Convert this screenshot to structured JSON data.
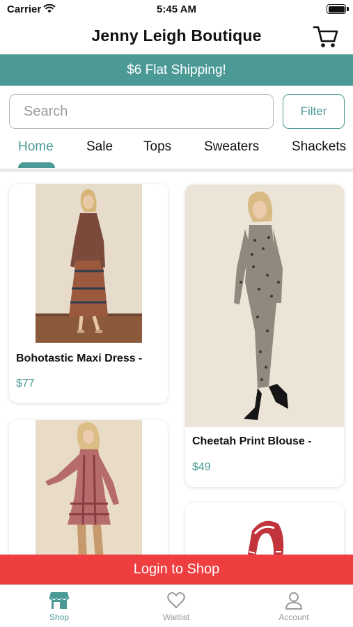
{
  "status": {
    "carrier": "Carrier",
    "time": "5:45 AM"
  },
  "nav": {
    "title": "Jenny Leigh Boutique",
    "cart_icon": "cart-icon"
  },
  "promo": {
    "text": "$6 Flat Shipping!"
  },
  "search": {
    "placeholder": "Search",
    "filter_label": "Filter"
  },
  "tabs": [
    {
      "label": "Home",
      "active": true
    },
    {
      "label": "Sale",
      "active": false
    },
    {
      "label": "Tops",
      "active": false
    },
    {
      "label": "Sweaters",
      "active": false
    },
    {
      "label": "Shackets",
      "active": false
    }
  ],
  "products": [
    {
      "title": "Bohotastic Maxi Dress -",
      "price": "$77"
    },
    {
      "title": "Cheetah Print Blouse -",
      "price": "$49"
    },
    {
      "title": "",
      "price": ""
    },
    {
      "title": "",
      "price": ""
    }
  ],
  "login_bar": {
    "label": "Login to Shop"
  },
  "tab_bar": [
    {
      "label": "Shop",
      "icon": "store-icon",
      "active": true
    },
    {
      "label": "Waitlist",
      "icon": "heart-icon",
      "active": false
    },
    {
      "label": "Account",
      "icon": "person-icon",
      "active": false
    }
  ],
  "colors": {
    "accent": "#4b9a96",
    "login_bar": "#ee3e40",
    "price": "#4b9a96"
  }
}
